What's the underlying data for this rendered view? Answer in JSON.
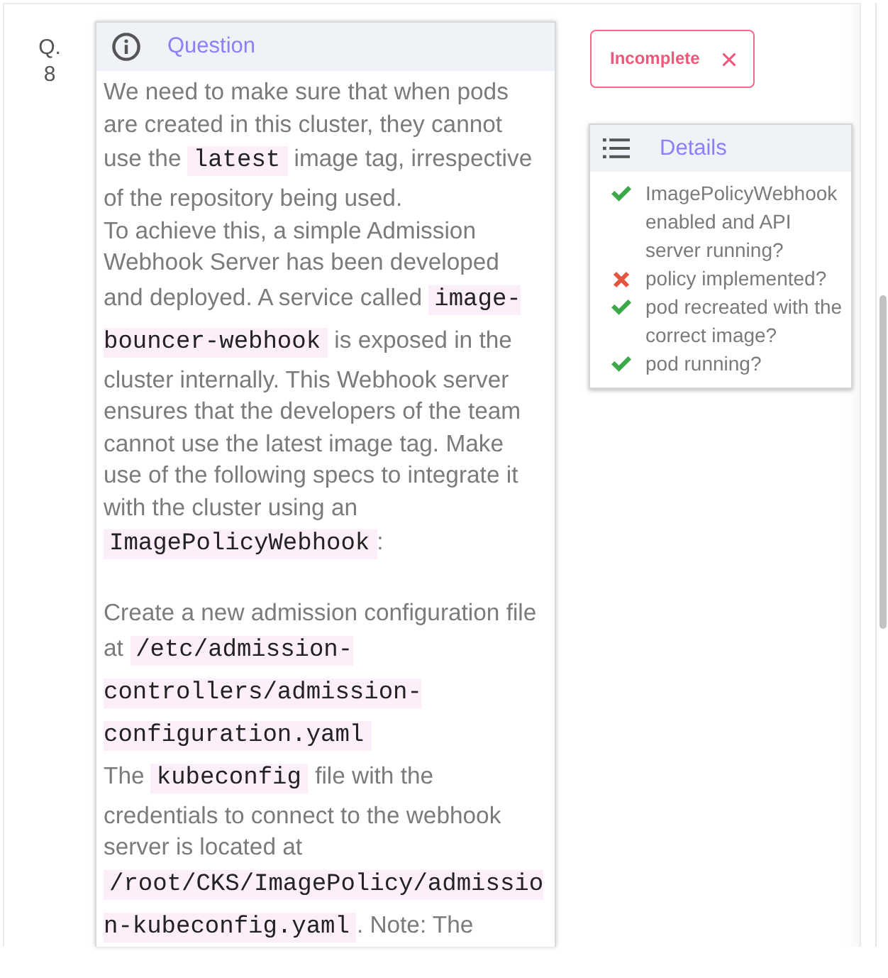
{
  "question": {
    "label": "Q.",
    "number": "8"
  },
  "question_card": {
    "title": "Question",
    "sections": [
      {
        "paragraphs": [
          {
            "segments": [
              {
                "kind": "text",
                "text": "We need to make sure that when pods are created in this cluster, they cannot use the "
              },
              {
                "kind": "code",
                "text": "latest"
              },
              {
                "kind": "text",
                "text": " image tag, irrespective of the repository being used."
              }
            ]
          },
          {
            "segments": [
              {
                "kind": "text",
                "text": "To achieve this, a simple Admission Webhook Server has been developed and deployed. A service called "
              },
              {
                "kind": "code",
                "text": "image-bouncer-webhook"
              },
              {
                "kind": "text",
                "text": " is exposed in the cluster internally. This Webhook server ensures that the developers of the team cannot use the latest image tag. Make use of the following specs to integrate it with the cluster using an "
              },
              {
                "kind": "code",
                "text": "ImagePolicyWebhook"
              },
              {
                "kind": "text",
                "text": ":"
              }
            ]
          }
        ]
      },
      {
        "paragraphs": [
          {
            "segments": [
              {
                "kind": "text",
                "text": "Create a new admission configuration file at "
              },
              {
                "kind": "code",
                "text": "/etc/admission-controllers/admission-configuration.yaml"
              }
            ]
          },
          {
            "segments": [
              {
                "kind": "text",
                "text": "The "
              },
              {
                "kind": "code",
                "text": "kubeconfig"
              },
              {
                "kind": "text",
                "text": " file with the credentials to connect to the webhook server is located at "
              },
              {
                "kind": "code",
                "text": "/root/CKS/ImagePolicy/admission-kubeconfig.yaml"
              },
              {
                "kind": "text",
                "text": ". Note: The"
              }
            ]
          }
        ]
      }
    ]
  },
  "status_badge": {
    "label": "Incomplete"
  },
  "details_card": {
    "title": "Details",
    "checks": [
      {
        "text": "ImagePolicyWebhook enabled and API server running?",
        "passed": true
      },
      {
        "text": "policy implemented?",
        "passed": false
      },
      {
        "text": "pod recreated with the correct image?",
        "passed": true
      },
      {
        "text": "pod running?",
        "passed": true
      }
    ]
  }
}
